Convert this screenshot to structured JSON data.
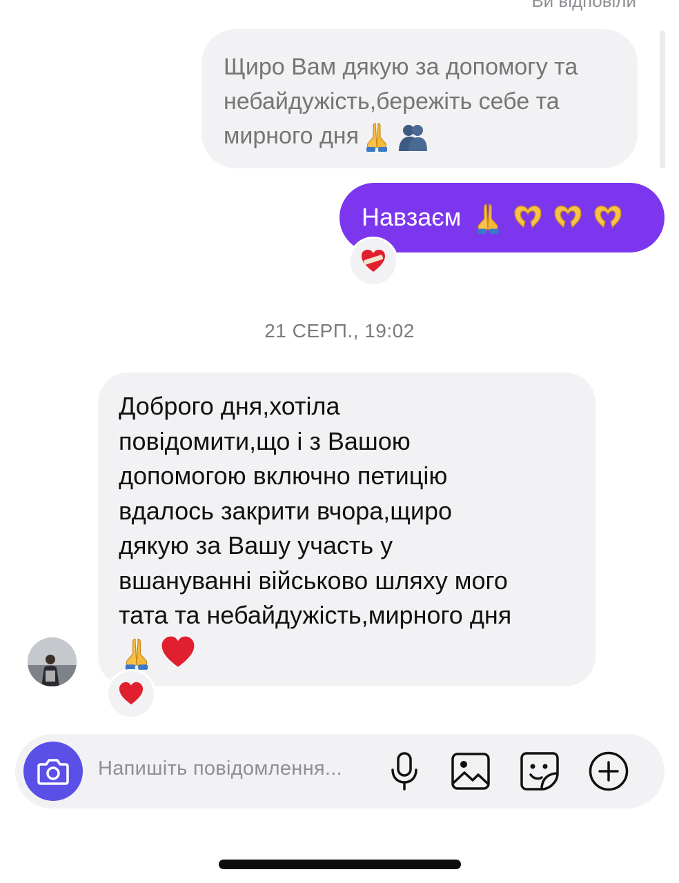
{
  "reply_context": {
    "label": "Ви відповіли",
    "quoted_text_lines": [
      "Щиро Вам дякую за допомогу та",
      "небайдужість,бережіть себе та",
      "мирного дня"
    ],
    "quoted_emojis": [
      "folded-hands",
      "two-people-hugging"
    ]
  },
  "sent_message": {
    "text": "Навзаєм",
    "emojis": [
      "folded-hands",
      "heart-hands",
      "heart-hands",
      "heart-hands"
    ],
    "bubble_color": "#7b36ee",
    "reaction": "mending-heart"
  },
  "timestamp": "21 СЕРП., 19:02",
  "received_message": {
    "text_lines": [
      "Доброго дня,хотіла",
      "повідомити,що і з Вашою",
      "допомогою включно петицію",
      "вдалось закрити вчора,щиро",
      "дякую за Вашу участь у",
      "вшануванні військово шляху мого",
      "тата та небайдужість,мирного дня"
    ],
    "emojis": [
      "folded-hands",
      "red-heart"
    ],
    "reaction": "red-heart",
    "sender_avatar": "avatar-photo"
  },
  "composer": {
    "placeholder": "Напишіть повідомлення...",
    "icons": [
      "camera-icon",
      "microphone-icon",
      "gallery-icon",
      "sticker-icon",
      "plus-circle-icon"
    ],
    "camera_color": "#5a4fe6"
  }
}
